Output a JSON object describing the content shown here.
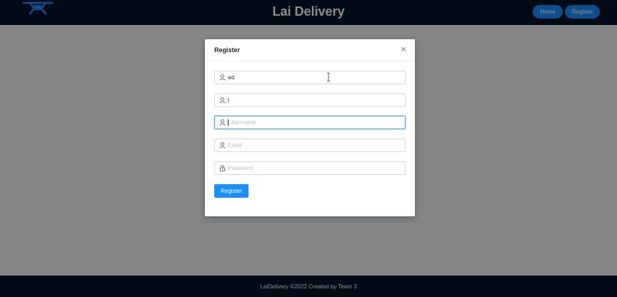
{
  "header": {
    "title": "Lai Delivery",
    "nav": {
      "home_label": "Home",
      "register_label": "Register"
    }
  },
  "footer": {
    "text": "LaiDelivery ©2022 Created by Team 3"
  },
  "modal": {
    "title": "Register",
    "close_icon": "close-icon",
    "fields": [
      {
        "icon": "user-icon",
        "value": "wz",
        "placeholder": ""
      },
      {
        "icon": "user-icon",
        "value": "l",
        "placeholder": ""
      },
      {
        "icon": "user-icon",
        "value": "",
        "placeholder": "Username"
      },
      {
        "icon": "user-icon",
        "value": "",
        "placeholder": "Email"
      },
      {
        "icon": "lock-icon",
        "value": "",
        "placeholder": "Password"
      }
    ],
    "submit_label": "Register"
  },
  "colors": {
    "header_bg": "#001529",
    "primary": "#1890ff",
    "focus_border": "#40a9ff"
  }
}
